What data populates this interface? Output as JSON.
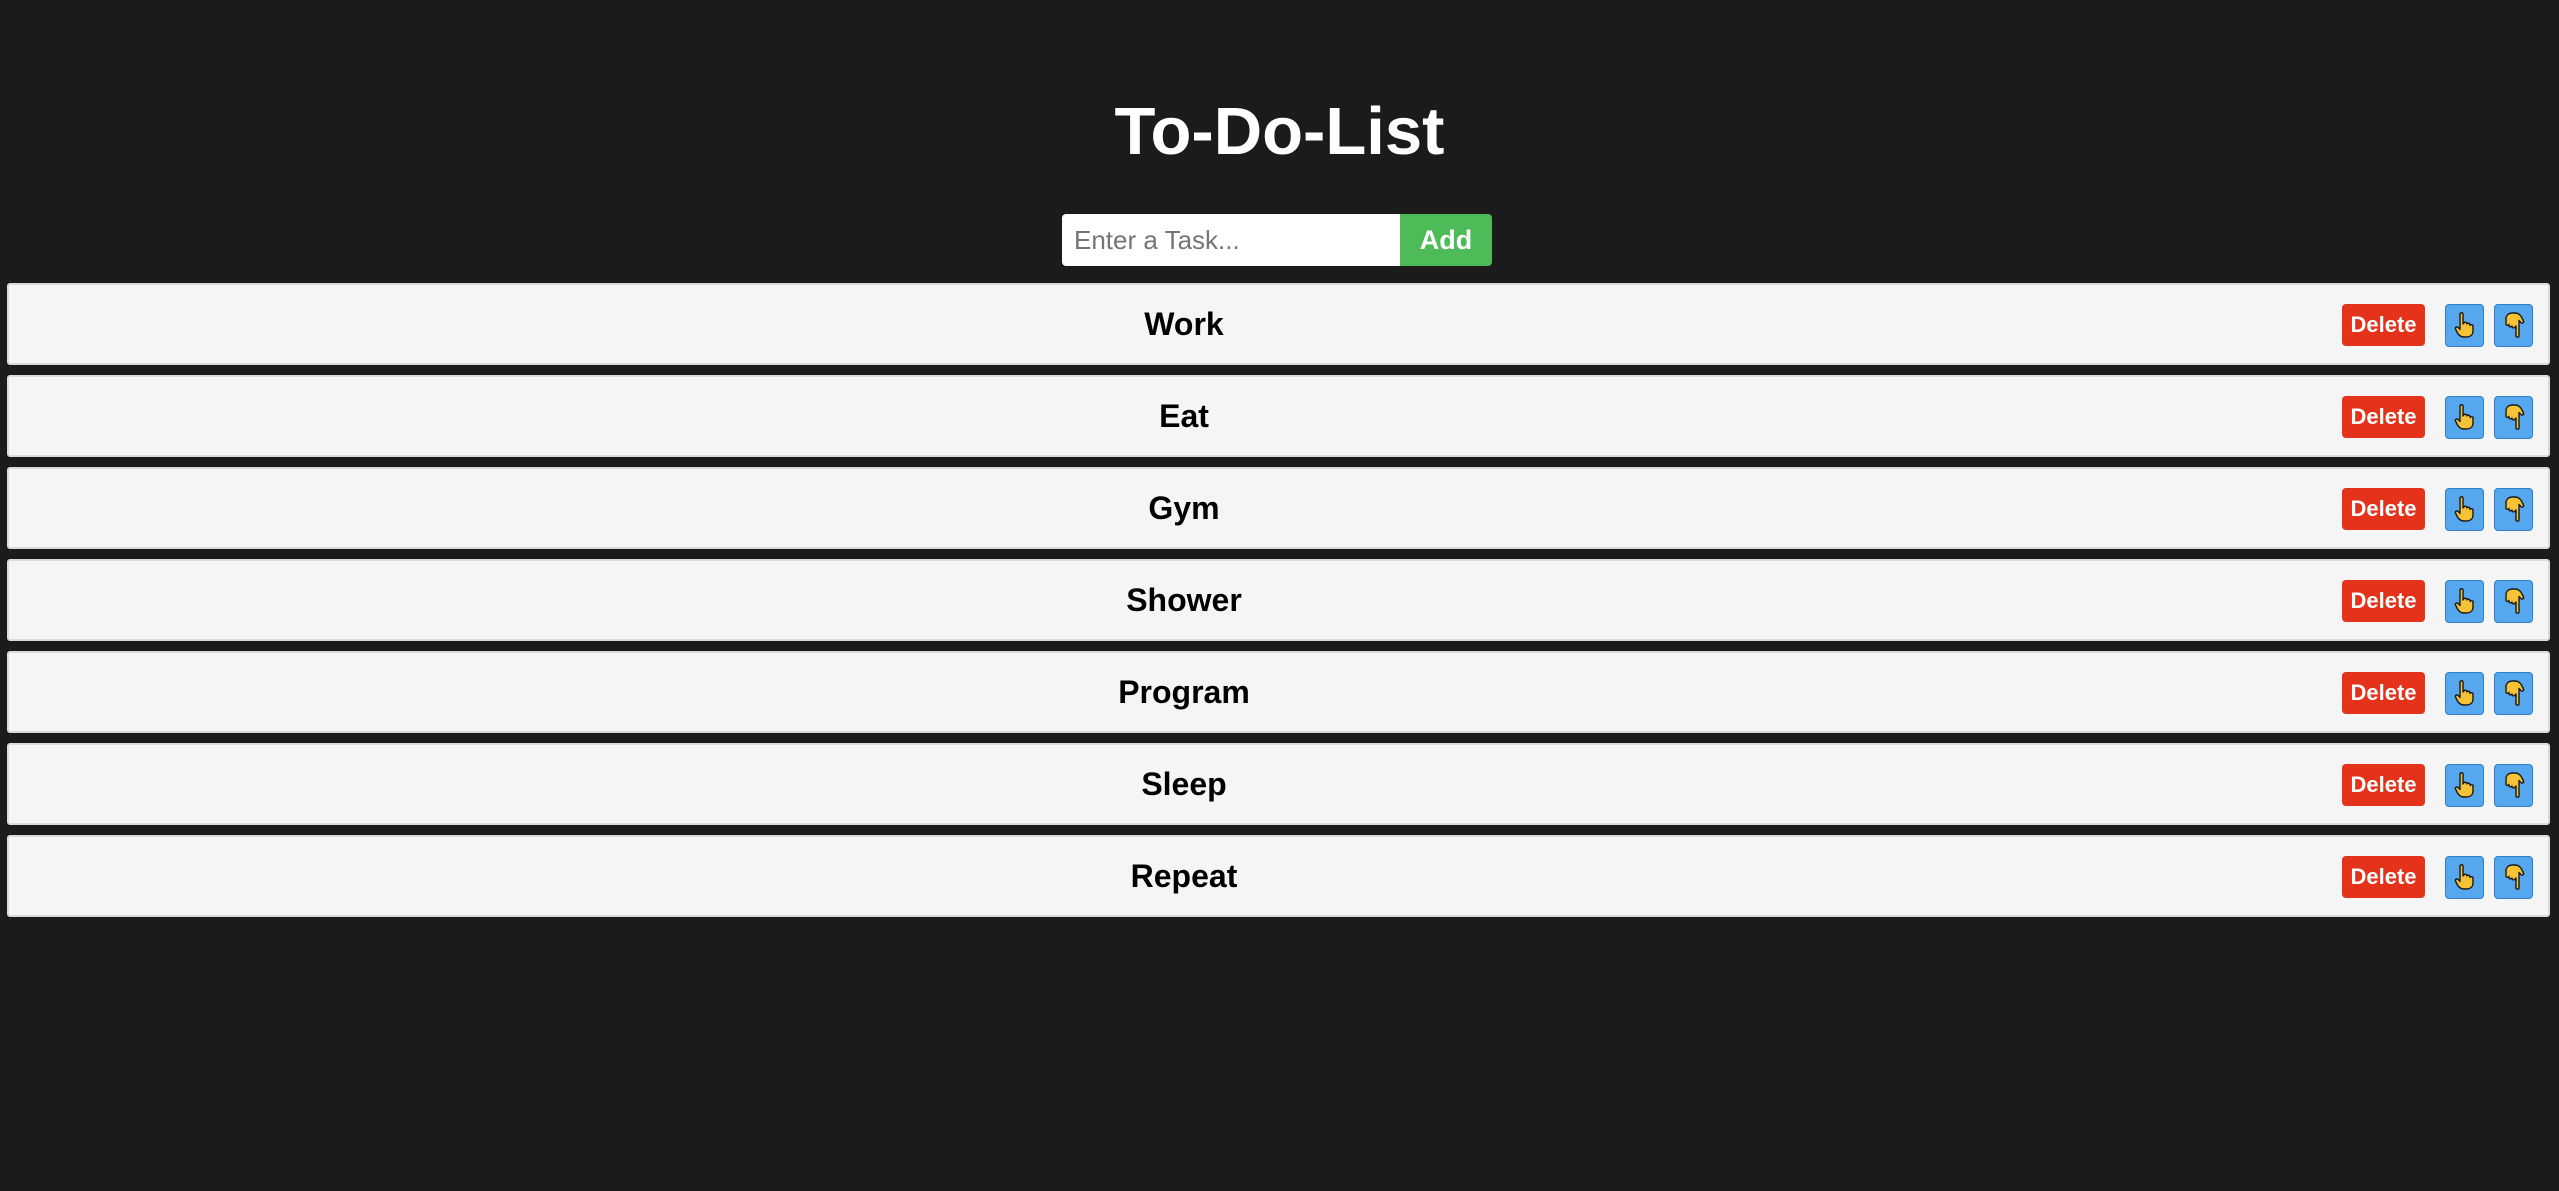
{
  "app": {
    "title": "To-Do-List"
  },
  "entry": {
    "placeholder": "Enter a Task...",
    "value": "",
    "add_label": "Add"
  },
  "tasks": [
    {
      "label": "Work"
    },
    {
      "label": "Eat"
    },
    {
      "label": "Gym"
    },
    {
      "label": "Shower"
    },
    {
      "label": "Program"
    },
    {
      "label": "Sleep"
    },
    {
      "label": "Repeat"
    }
  ],
  "row_controls": {
    "delete_label": "Delete",
    "move_up_icon": "pointing-up-hand-icon",
    "move_down_icon": "pointing-down-hand-icon"
  },
  "colors": {
    "background": "#1b1b1b",
    "add_button": "#4cbb58",
    "delete_button": "#e5321a",
    "move_button": "#55a7ee",
    "hand_icon": "#f6c236",
    "row_background": "#f5f5f5"
  }
}
